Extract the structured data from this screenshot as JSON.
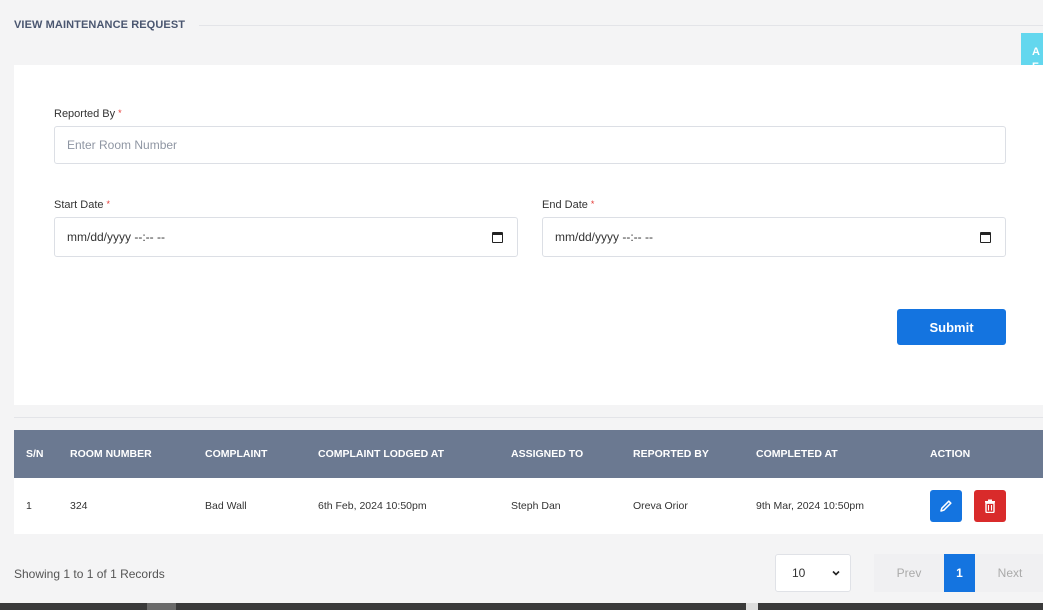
{
  "header": {
    "title": "VIEW MAINTENANCE REQUEST"
  },
  "float_tab": {
    "text": "A\nF"
  },
  "form": {
    "reported_by": {
      "label": "Reported By",
      "required": "*",
      "placeholder": "Enter Room Number",
      "value": ""
    },
    "start_date": {
      "label": "Start Date",
      "required": "*",
      "value": "mm/dd/yyyy --:-- --"
    },
    "end_date": {
      "label": "End Date",
      "required": "*",
      "value": "mm/dd/yyyy --:-- --"
    },
    "submit_label": "Submit"
  },
  "table": {
    "columns": [
      "S/N",
      "ROOM NUMBER",
      "COMPLAINT",
      "COMPLAINT LODGED AT",
      "ASSIGNED TO",
      "REPORTED BY",
      "COMPLETED AT",
      "ACTION"
    ],
    "rows": [
      {
        "sn": "1",
        "room_number": "324",
        "complaint": "Bad Wall",
        "lodged_at": "6th Feb, 2024 10:50pm",
        "assigned_to": "Steph Dan",
        "reported_by": "Oreva Orior",
        "completed_at": "9th Mar, 2024 10:50pm",
        "actions": [
          "edit-icon",
          "trash-icon"
        ]
      }
    ]
  },
  "footer": {
    "showing_text": "Showing 1 to 1 of 1 Records",
    "page_size": "10",
    "prev_label": "Prev",
    "current_page": "1",
    "next_label": "Next"
  },
  "colors": {
    "primary": "#1474e0",
    "danger": "#d92b2b",
    "table_header": "#6b7991",
    "accent_tab": "#63d7ee"
  }
}
